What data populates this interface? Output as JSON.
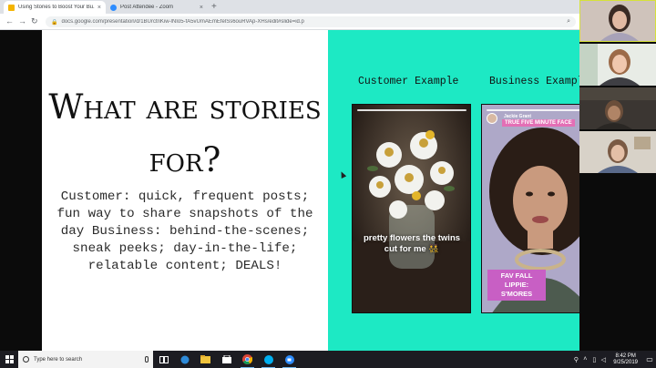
{
  "browser": {
    "tabs": [
      {
        "label": "Using Stories to Boost Your Bu...",
        "active": true,
        "favicon_color": "#f4b400"
      },
      {
        "label": "Post Attendee - Zoom",
        "active": false,
        "favicon_color": "#2d8cff"
      }
    ],
    "new_tab_symbol": "+",
    "close_symbol": "×",
    "url": "docs.google.com/presentation/d/1BUrctriKiw-lNIo5-fA5vUmAEmEfelSs6ouRVAp-XHs/edit#slide=id.p"
  },
  "slide": {
    "title": "What are stories for?",
    "body": "Customer: quick, frequent posts; fun way to share snapshots of the day Business: behind-the-scenes; sneak peeks; day-in-the-life; relatable content; DEALS!",
    "customer_label": "Customer Example",
    "business_label": "Business Example",
    "customer_story_caption": "pretty flowers the twins cut for me 👯",
    "business_story_name": "Jackie Grant",
    "business_story_tag": "TRUE FIVE MINUTE FACE",
    "business_story_caption": "FAV FALL LIPPIE: S'MORES",
    "accent_color": "#1de9c4"
  },
  "taskbar": {
    "search_placeholder": "Type here to search",
    "time": "8:42 PM",
    "date": "9/25/2019"
  }
}
